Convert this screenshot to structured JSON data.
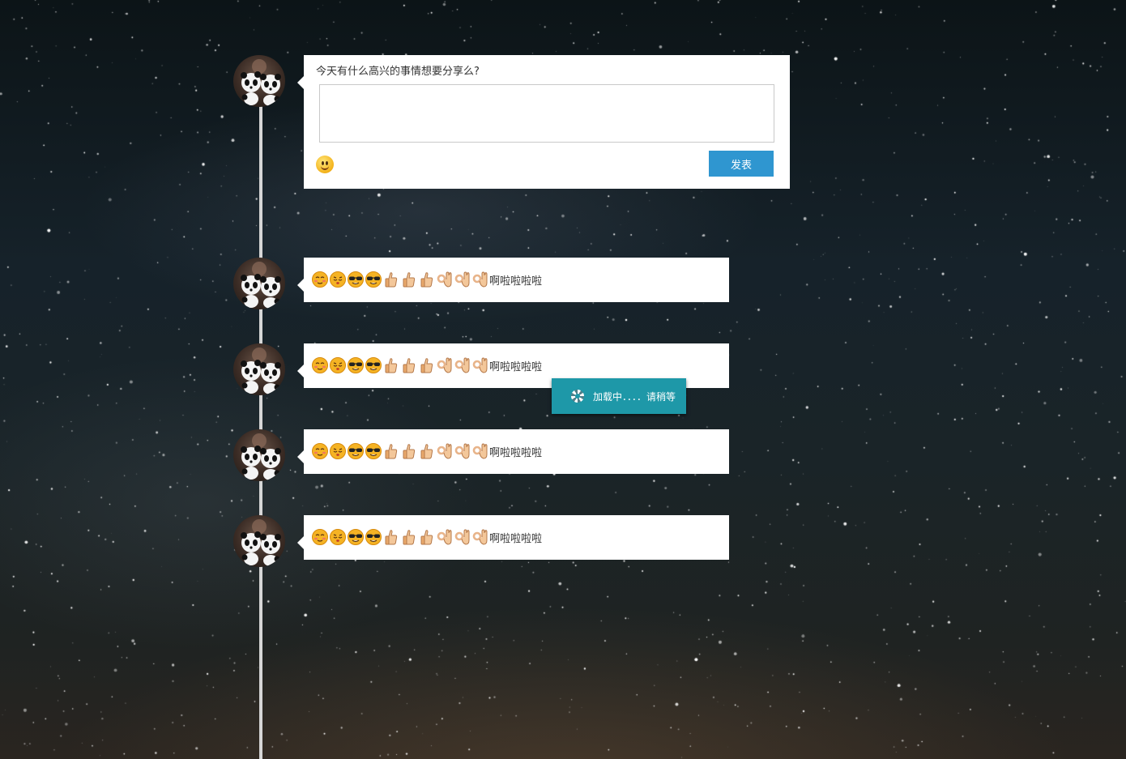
{
  "composer": {
    "prompt": "今天有什么高兴的事情想要分享么?",
    "input_value": "",
    "emoji_icon": "smiley-face-icon",
    "publish_label": "发表"
  },
  "posts": [
    {
      "emojis": [
        "blush",
        "kiss",
        "sunglasses",
        "sunglasses",
        "thumbs-up",
        "thumbs-up",
        "thumbs-up",
        "ok-hand",
        "ok-hand",
        "ok-hand"
      ],
      "text": "啊啦啦啦啦"
    },
    {
      "emojis": [
        "blush",
        "kiss",
        "sunglasses",
        "sunglasses",
        "thumbs-up",
        "thumbs-up",
        "thumbs-up",
        "ok-hand",
        "ok-hand",
        "ok-hand"
      ],
      "text": "啊啦啦啦啦"
    },
    {
      "emojis": [
        "blush",
        "kiss",
        "sunglasses",
        "sunglasses",
        "thumbs-up",
        "thumbs-up",
        "thumbs-up",
        "ok-hand",
        "ok-hand",
        "ok-hand"
      ],
      "text": "啊啦啦啦啦"
    },
    {
      "emojis": [
        "blush",
        "kiss",
        "sunglasses",
        "sunglasses",
        "thumbs-up",
        "thumbs-up",
        "thumbs-up",
        "ok-hand",
        "ok-hand",
        "ok-hand"
      ],
      "text": "啊啦啦啦啦"
    }
  ],
  "loading": {
    "icon": "spinner-icon",
    "text": "加载中．．．．请稍等"
  },
  "colors": {
    "publish_button": "#2f96d0",
    "loading_toast": "#1e98a8",
    "timeline": "#d6d6d6",
    "card": "#ffffff"
  }
}
